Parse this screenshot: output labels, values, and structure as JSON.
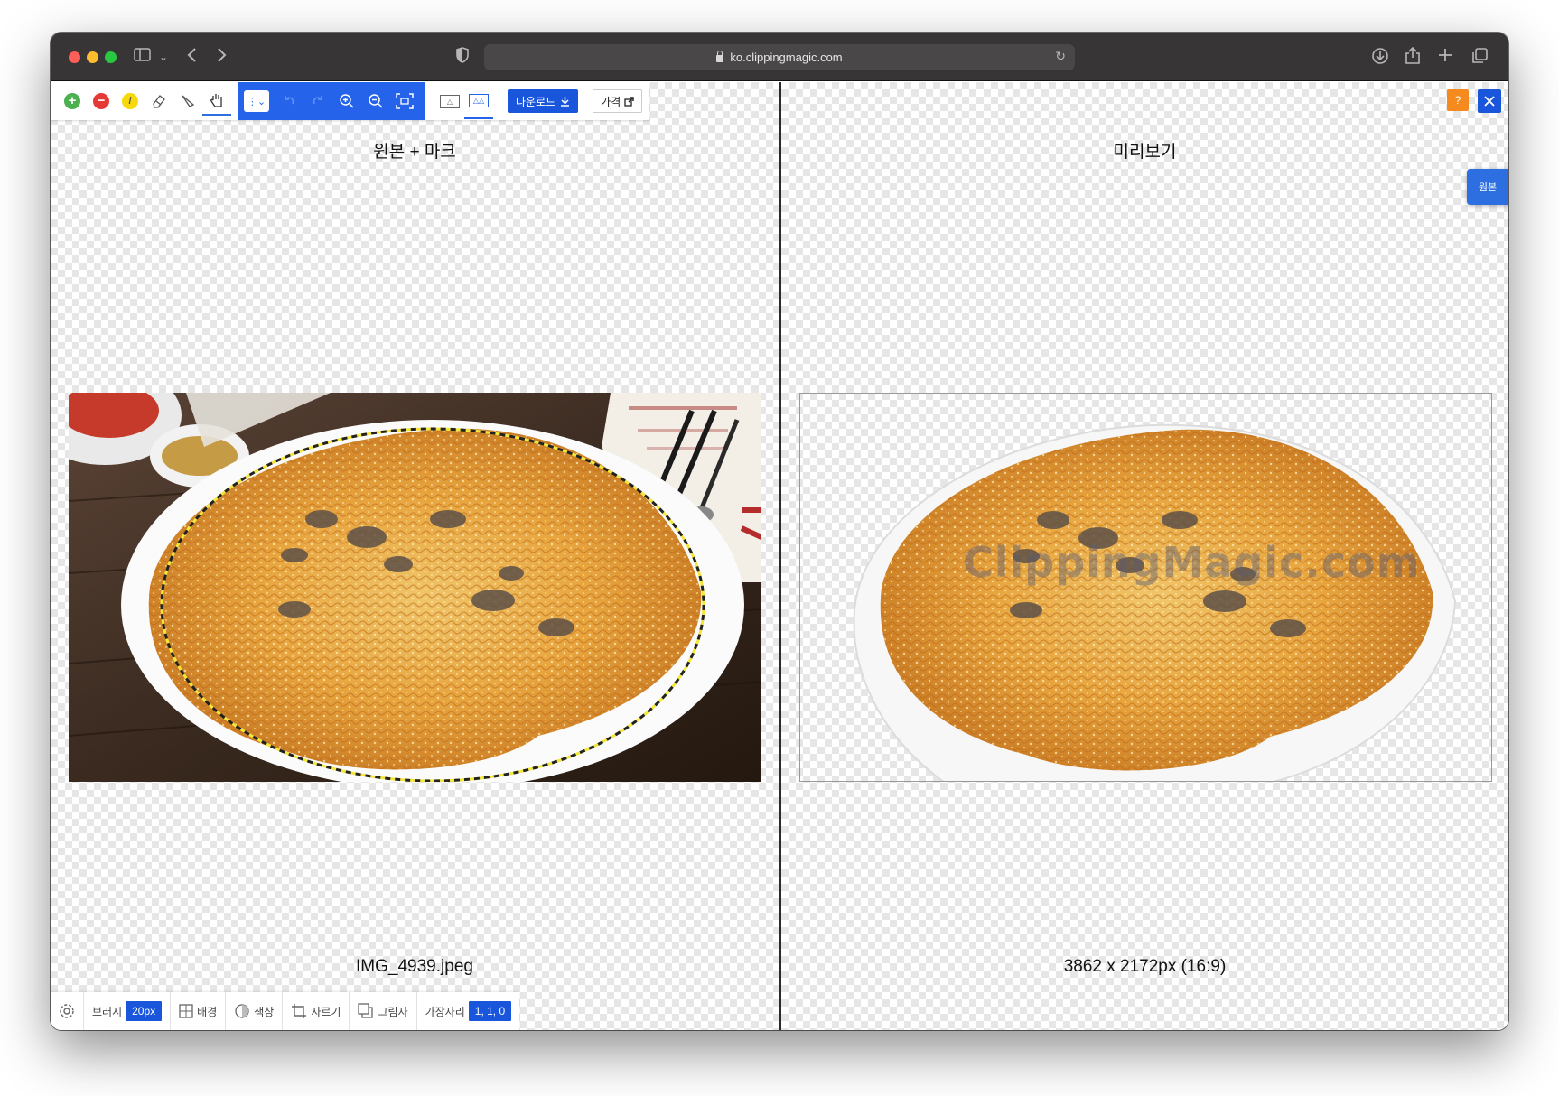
{
  "browser": {
    "url": "ko.clippingmagic.com"
  },
  "toolbar": {
    "download_label": "다운로드",
    "price_label": "가격",
    "help_label": "?"
  },
  "left_pane": {
    "title": "원본 + 마크",
    "caption": "IMG_4939.jpeg"
  },
  "right_pane": {
    "title": "미리보기",
    "caption": "3862 x 2172px (16:9)",
    "side_tab": "원본",
    "watermark": "ClippingMagic.com"
  },
  "bottombar": {
    "brush_label": "브러시",
    "brush_value": "20px",
    "background_label": "배경",
    "color_label": "색상",
    "crop_label": "자르기",
    "shadow_label": "그림자",
    "edge_label": "가장자리",
    "edge_value": "1, 1, 0"
  },
  "colors": {
    "accent": "#1a56db",
    "keep_green": "#4caf50",
    "remove_red": "#e53935",
    "highlight_yellow": "#f5d90a",
    "help_orange": "#f58a1f"
  },
  "icons": [
    "sidebar-icon",
    "back-icon",
    "forward-icon",
    "shield-icon",
    "download-icon",
    "share-icon",
    "plus-icon",
    "tabs-icon",
    "keep-icon",
    "remove-icon",
    "hair-icon",
    "eraser-icon",
    "scalpel-icon",
    "hand-icon",
    "undo-icon",
    "redo-icon",
    "zoom-in-icon",
    "zoom-out-icon",
    "fit-icon",
    "settings-icon"
  ]
}
